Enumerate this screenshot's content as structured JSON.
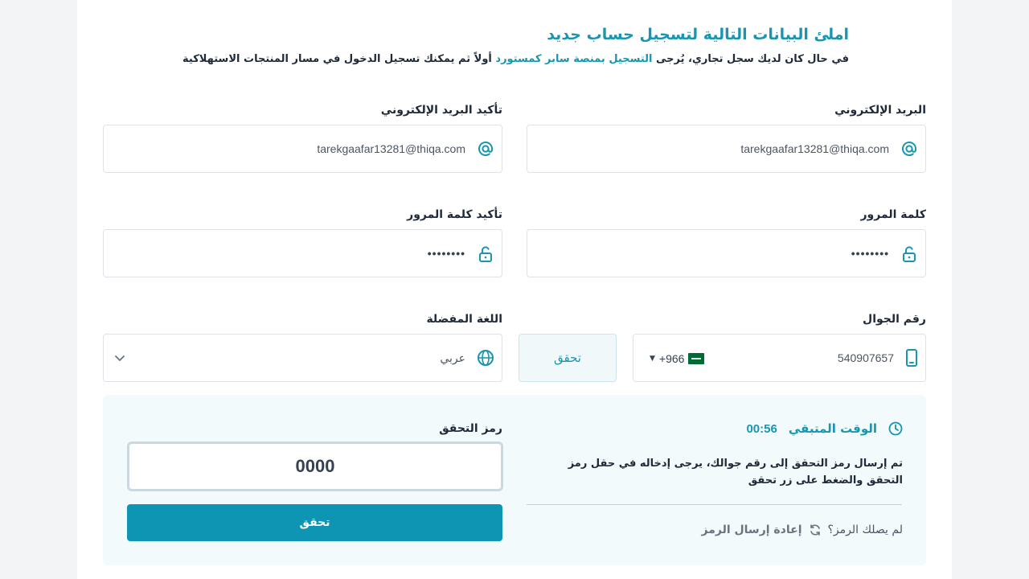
{
  "header": {
    "title": "املئ البيانات التالية لتسجيل حساب جديد",
    "subtitle_part1": "في حال كان لديك سجل تجاري، يُرجى",
    "subtitle_link": "التسجيل بمنصة سابر كمستورد",
    "subtitle_part2": "أولاً ثم يمكنك تسجيل الدخول في مسار المنتجات الاستهلاكية"
  },
  "form": {
    "email": {
      "label": "البريد الإلكتروني",
      "value": "tarekgaafar13281@thiqa.com",
      "icon": "at-icon"
    },
    "email_confirm": {
      "label": "تأكيد البريد الإلكتروني",
      "value": "tarekgaafar13281@thiqa.com",
      "icon": "at-icon"
    },
    "password": {
      "label": "كلمة المرور",
      "value": "••••••••",
      "icon": "lock-icon"
    },
    "password_confirm": {
      "label": "تأكيد كلمة المرور",
      "value": "••••••••",
      "icon": "lock-icon"
    },
    "mobile": {
      "label": "رقم الجوال",
      "value": "540907657",
      "country_code": "+966",
      "icon": "phone-icon"
    },
    "verify_small": {
      "label": "تحقق"
    },
    "language": {
      "label": "اللغة المفضلة",
      "value": "عربي",
      "icon": "globe-icon"
    }
  },
  "otp": {
    "timer_label": "الوقت المتبقي",
    "timer_value": "00:56",
    "message": "تم إرسال رمز التحقق إلى رقم جوالك، يرجى إدخاله في حقل رمز التحقق والضغط على زر تحقق",
    "resend_question": "لم يصلك الرمز؟",
    "resend_link": "إعادة إرسال الرمز",
    "code_label": "رمز التحقق",
    "code_value": "0000",
    "verify_button": "تحقق"
  },
  "colors": {
    "accent": "#1795b1",
    "button": "#0f95b4",
    "panel": "#f2fafc",
    "flag": "#006c35"
  }
}
